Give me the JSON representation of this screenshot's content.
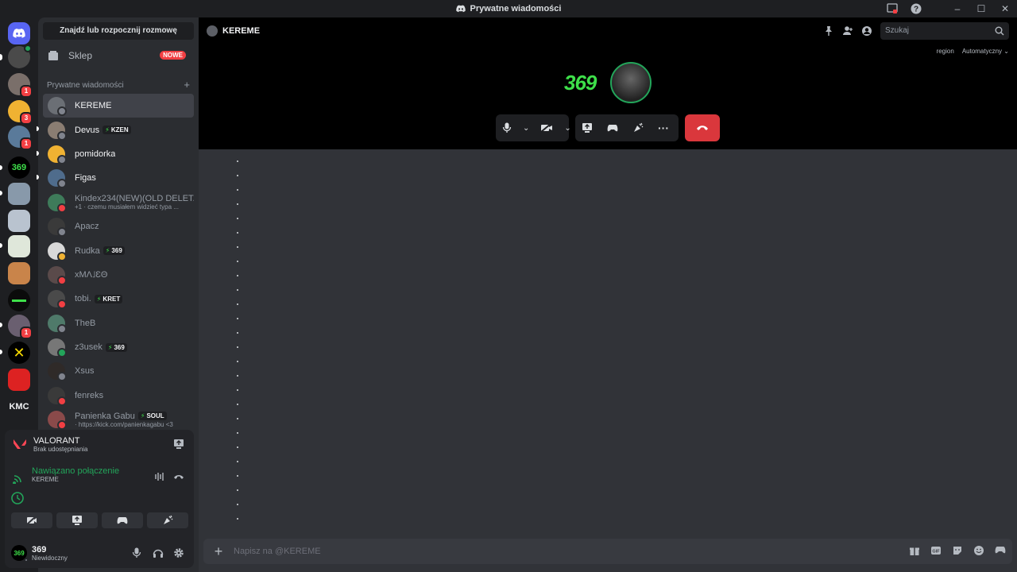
{
  "window": {
    "title": "Prywatne wiadomości"
  },
  "sidebar": {
    "find_button": "Znajdź lub rozpocznij rozmowę",
    "shop_label": "Sklep",
    "shop_badge": "NOWE",
    "dm_header": "Prywatne wiadomości",
    "dm_add": "+",
    "dms": [
      {
        "name": "KEREME",
        "status": "offline",
        "avatar_color": "#6b6f75"
      },
      {
        "name": "Devus",
        "tag": "KZEN",
        "status": "offline",
        "avatar_color": "#8a7d72"
      },
      {
        "name": "pomidorka",
        "status": "offline",
        "avatar_color": "#f0b232"
      },
      {
        "name": "Figas",
        "status": "offline",
        "avatar_color": "#4f6c8c"
      },
      {
        "name": "Kindex234(NEW)(OLD DELET...",
        "sub": "+1 · czemu musiałem widzieć typa ...",
        "status": "dnd",
        "avatar_color": "#3e7b5a"
      },
      {
        "name": "Apacz",
        "status": "offline",
        "avatar_color": "#3a3a3a"
      },
      {
        "name": "Rudka",
        "tag": "369",
        "status": "idle",
        "avatar_color": "#d8d8d8"
      },
      {
        "name": "xMΛ˩ƐΘ",
        "status": "dnd",
        "avatar_color": "#5a4a4a"
      },
      {
        "name": "tobi.",
        "tag": "KRET",
        "status": "dnd",
        "avatar_color": "#4a4a4a"
      },
      {
        "name": "TheB",
        "status": "offline",
        "avatar_color": "#4f7a6a"
      },
      {
        "name": "z3usek",
        "tag": "369",
        "status": "online",
        "avatar_color": "#777"
      },
      {
        "name": "Xsus",
        "status": "offline",
        "avatar_color": "#2f2a28"
      },
      {
        "name": "fenreks",
        "status": "dnd",
        "avatar_color": "#3a3a3a"
      },
      {
        "name": "Panienka Gabu",
        "tag": "SOUL",
        "sub": "· https://kick.com/panienkagabu <3",
        "status": "dnd",
        "avatar_color": "#8a4a4a"
      }
    ]
  },
  "panel": {
    "activity_title": "VALORANT",
    "activity_sub": "Brak udostępniania",
    "voice_status": "Nawiązano połączenie",
    "voice_channel": "KEREME",
    "user_name": "369",
    "user_status": "Niewidoczny"
  },
  "main": {
    "header_name": "KEREME",
    "search_placeholder": "Szukaj",
    "region_label": "region",
    "region_value": "Automatyczny",
    "tile_369": "369",
    "composer_placeholder": "Napisz na @KEREME"
  },
  "rail": {
    "kmc_label": "KMC",
    "servers": [
      {
        "badge": "",
        "color": "#5865f2"
      },
      {
        "badge": "",
        "color": "#555"
      },
      {
        "badge": "1",
        "color": "#7a6f6a"
      },
      {
        "badge": "3",
        "color": "#f0b232"
      },
      {
        "badge": "1",
        "color": "#5a7a9a"
      },
      {
        "badge": "",
        "color": "#000"
      },
      {
        "badge": "",
        "color": "#8899aa"
      },
      {
        "badge": "",
        "color": "#b9c3cf"
      },
      {
        "badge": "",
        "color": "#dfe7da"
      },
      {
        "badge": "",
        "color": "#c9844a"
      },
      {
        "badge": "",
        "color": "#000"
      },
      {
        "badge": "1",
        "color": "#6a5f70"
      },
      {
        "badge": "",
        "color": "#000"
      },
      {
        "badge": "",
        "color": "#d22"
      }
    ]
  },
  "colors": {
    "accent": "#5865f2",
    "online": "#23a55a",
    "dnd": "#f23f43",
    "idle": "#f0b232",
    "offline": "#80848e",
    "end_call": "#da373c"
  }
}
